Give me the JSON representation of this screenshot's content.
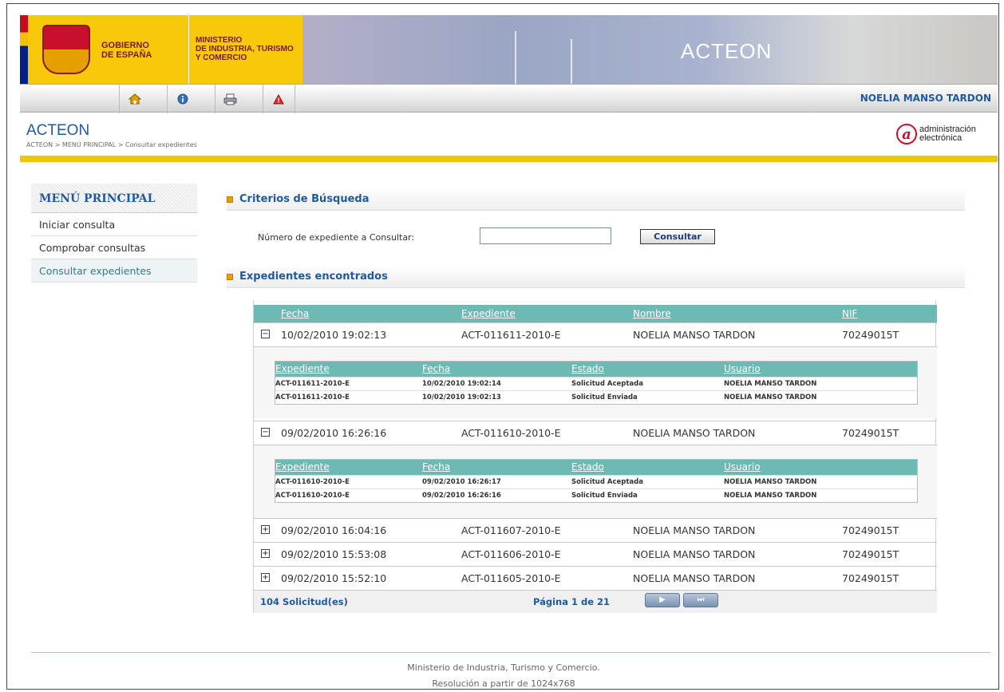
{
  "header": {
    "gov_lines": [
      "GOBIERNO",
      "DE ESPAÑA"
    ],
    "ministry_lines": [
      "MINISTERIO",
      "DE INDUSTRIA, TURISMO",
      "Y COMERCIO"
    ],
    "banner_title": "ACTEON",
    "user": "NOELIA MANSO TARDON",
    "app_title": "ACTEON",
    "breadcrumb": "ACTEON > MENÚ PRINCIPAL > Consultar expedientes",
    "ae_logo_lines": [
      "administración",
      "electrónica"
    ]
  },
  "toolbar": {
    "icons": [
      "home-icon",
      "info-icon",
      "print-icon",
      "alert-icon"
    ]
  },
  "sidebar": {
    "title": "MENÚ PRINCIPAL",
    "items": [
      {
        "label": "Iniciar consulta"
      },
      {
        "label": "Comprobar consultas"
      },
      {
        "label": "Consultar expedientes",
        "active": true
      }
    ]
  },
  "search": {
    "section_title": "Criterios de Búsqueda",
    "label": "Número de expediente a Consultar:",
    "value": "",
    "button": "Consultar"
  },
  "results": {
    "section_title": "Expedientes encontrados",
    "columns": [
      "Fecha",
      "Expediente",
      "Nombre",
      "NIF"
    ],
    "sub_columns": [
      "Expediente",
      "Fecha",
      "Estado",
      "Usuario"
    ],
    "rows": [
      {
        "toggle": "−",
        "fecha": "10/02/2010 19:02:13",
        "expediente": "ACT-011611-2010-E",
        "nombre": "NOELIA MANSO TARDON",
        "nif": "70249015T",
        "details": [
          {
            "expediente": "ACT-011611-2010-E",
            "fecha": "10/02/2010 19:02:14",
            "estado": "Solicitud Aceptada",
            "usuario": "NOELIA MANSO TARDON"
          },
          {
            "expediente": "ACT-011611-2010-E",
            "fecha": "10/02/2010 19:02:13",
            "estado": "Solicitud Enviada",
            "usuario": "NOELIA MANSO TARDON"
          }
        ]
      },
      {
        "toggle": "−",
        "fecha": "09/02/2010 16:26:16",
        "expediente": "ACT-011610-2010-E",
        "nombre": "NOELIA MANSO TARDON",
        "nif": "70249015T",
        "details": [
          {
            "expediente": "ACT-011610-2010-E",
            "fecha": "09/02/2010 16:26:17",
            "estado": "Solicitud Aceptada",
            "usuario": "NOELIA MANSO TARDON"
          },
          {
            "expediente": "ACT-011610-2010-E",
            "fecha": "09/02/2010 16:26:16",
            "estado": "Solicitud Enviada",
            "usuario": "NOELIA MANSO TARDON"
          }
        ]
      },
      {
        "toggle": "+",
        "fecha": "09/02/2010 16:04:16",
        "expediente": "ACT-011607-2010-E",
        "nombre": "NOELIA MANSO TARDON",
        "nif": "70249015T"
      },
      {
        "toggle": "+",
        "fecha": "09/02/2010 15:53:08",
        "expediente": "ACT-011606-2010-E",
        "nombre": "NOELIA MANSO TARDON",
        "nif": "70249015T"
      },
      {
        "toggle": "+",
        "fecha": "09/02/2010 15:52:10",
        "expediente": "ACT-011605-2010-E",
        "nombre": "NOELIA MANSO TARDON",
        "nif": "70249015T"
      }
    ],
    "count": "104 Solicitud(es)",
    "page": "Página 1 de 21",
    "next_button": "▶",
    "last_button": "⏭"
  },
  "footer": {
    "line1": "Ministerio de Industria, Turismo y Comercio.",
    "line2": "Resolución a partir de 1024x768"
  },
  "colors": {
    "accent_blue": "#1f5aa0",
    "teal_header": "#6dbab5",
    "yellow": "#f3c500"
  }
}
